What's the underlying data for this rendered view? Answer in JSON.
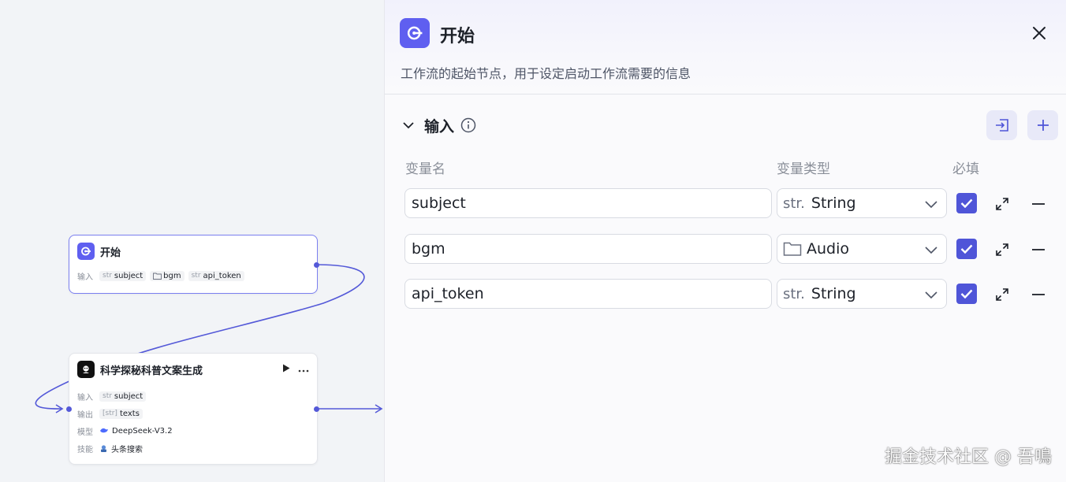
{
  "canvas": {
    "start_node": {
      "title": "开始",
      "input_label": "输入",
      "inputs": [
        {
          "type": "str",
          "name": "subject"
        },
        {
          "type": "folder-icon",
          "name": "bgm"
        },
        {
          "type": "str",
          "name": "api_token"
        }
      ]
    },
    "llm_node": {
      "title": "科学探秘科普文案生成",
      "rows": [
        {
          "label": "输入",
          "type": "str",
          "value": "subject"
        },
        {
          "label": "输出",
          "type": "[str]",
          "value": "texts"
        },
        {
          "label": "模型",
          "type": "deepseek-icon",
          "value": "DeepSeek-V3.2"
        },
        {
          "label": "技能",
          "type": "toutiao-icon",
          "value": "头条搜索"
        }
      ]
    }
  },
  "panel": {
    "title": "开始",
    "description": "工作流的起始节点，用于设定启动工作流需要的信息",
    "section_title": "输入",
    "columns": {
      "name": "变量名",
      "type": "变量类型",
      "required": "必填"
    },
    "variables": [
      {
        "name": "subject",
        "type_prefix": "str.",
        "type": "String",
        "required": true
      },
      {
        "name": "bgm",
        "type_prefix": "folder-icon",
        "type": "Audio",
        "required": true
      },
      {
        "name": "api_token",
        "type_prefix": "str.",
        "type": "String",
        "required": true
      }
    ]
  },
  "watermark": "掘金技术社区 @ 吾鳴",
  "colors": {
    "accent": "#5f5ff0",
    "edge": "#5459d8",
    "check": "#4f55d8"
  }
}
